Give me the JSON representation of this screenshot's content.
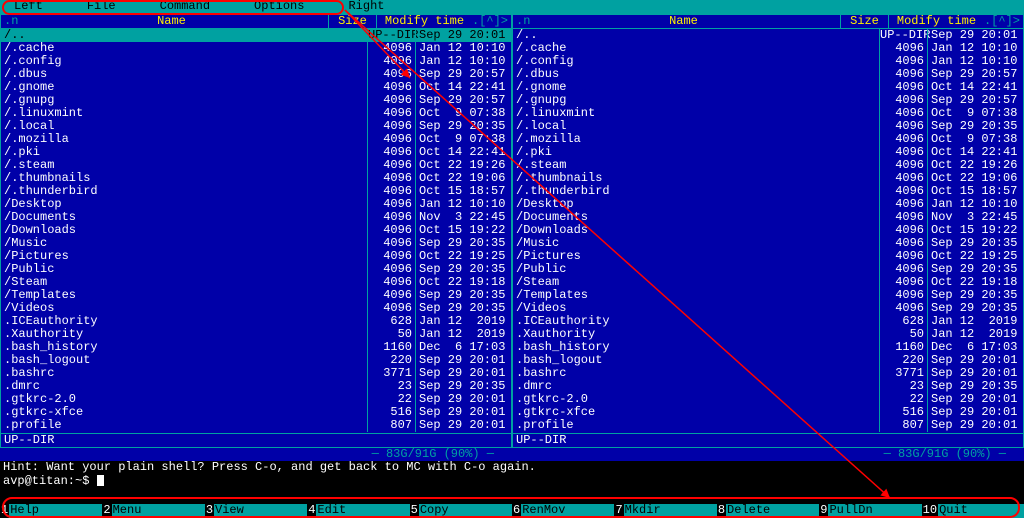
{
  "menubar": [
    "Left",
    "File",
    "Command",
    "Options",
    "Right"
  ],
  "header": {
    "dotn": ".n",
    "name": "Name",
    "size": "Size",
    "mtime": "Modify time",
    "corner": ".[^]>"
  },
  "selected_row": {
    "name": "/..",
    "size": "UP--DIR",
    "mtime": "Sep 29 20:01"
  },
  "rows": [
    {
      "name": "/.cache",
      "size": "4096",
      "mtime": "Jan 12 10:10"
    },
    {
      "name": "/.config",
      "size": "4096",
      "mtime": "Jan 12 10:10"
    },
    {
      "name": "/.dbus",
      "size": "4096",
      "mtime": "Sep 29 20:57"
    },
    {
      "name": "/.gnome",
      "size": "4096",
      "mtime": "Oct 14 22:41"
    },
    {
      "name": "/.gnupg",
      "size": "4096",
      "mtime": "Sep 29 20:57"
    },
    {
      "name": "/.linuxmint",
      "size": "4096",
      "mtime": "Oct  9 07:38"
    },
    {
      "name": "/.local",
      "size": "4096",
      "mtime": "Sep 29 20:35"
    },
    {
      "name": "/.mozilla",
      "size": "4096",
      "mtime": "Oct  9 07:38"
    },
    {
      "name": "/.pki",
      "size": "4096",
      "mtime": "Oct 14 22:41"
    },
    {
      "name": "/.steam",
      "size": "4096",
      "mtime": "Oct 22 19:26"
    },
    {
      "name": "/.thumbnails",
      "size": "4096",
      "mtime": "Oct 22 19:06"
    },
    {
      "name": "/.thunderbird",
      "size": "4096",
      "mtime": "Oct 15 18:57"
    },
    {
      "name": "/Desktop",
      "size": "4096",
      "mtime": "Jan 12 10:10"
    },
    {
      "name": "/Documents",
      "size": "4096",
      "mtime": "Nov  3 22:45"
    },
    {
      "name": "/Downloads",
      "size": "4096",
      "mtime": "Oct 15 19:22"
    },
    {
      "name": "/Music",
      "size": "4096",
      "mtime": "Sep 29 20:35"
    },
    {
      "name": "/Pictures",
      "size": "4096",
      "mtime": "Oct 22 19:25"
    },
    {
      "name": "/Public",
      "size": "4096",
      "mtime": "Sep 29 20:35"
    },
    {
      "name": "/Steam",
      "size": "4096",
      "mtime": "Oct 22 19:18"
    },
    {
      "name": "/Templates",
      "size": "4096",
      "mtime": "Sep 29 20:35"
    },
    {
      "name": "/Videos",
      "size": "4096",
      "mtime": "Sep 29 20:35"
    },
    {
      "name": " .ICEauthority",
      "size": "628",
      "mtime": "Jan 12  2019"
    },
    {
      "name": " .Xauthority",
      "size": "50",
      "mtime": "Jan 12  2019"
    },
    {
      "name": " .bash_history",
      "size": "1160",
      "mtime": "Dec  6 17:03"
    },
    {
      "name": " .bash_logout",
      "size": "220",
      "mtime": "Sep 29 20:01"
    },
    {
      "name": " .bashrc",
      "size": "3771",
      "mtime": "Sep 29 20:01"
    },
    {
      "name": " .dmrc",
      "size": "23",
      "mtime": "Sep 29 20:35"
    },
    {
      "name": " .gtkrc-2.0",
      "size": "22",
      "mtime": "Sep 29 20:01"
    },
    {
      "name": " .gtkrc-xfce",
      "size": "516",
      "mtime": "Sep 29 20:01"
    },
    {
      "name": " .profile",
      "size": "807",
      "mtime": "Sep 29 20:01"
    }
  ],
  "status": "UP--DIR",
  "diskfree": "─ 83G/91G (90%) ─",
  "hint": "Hint: Want your plain shell? Press C-o, and get back to MC with C-o again.",
  "prompt": "avp@titan:~$ ",
  "fkeys": [
    {
      "n": "1",
      "l": "Help"
    },
    {
      "n": "2",
      "l": "Menu"
    },
    {
      "n": "3",
      "l": "View"
    },
    {
      "n": "4",
      "l": "Edit"
    },
    {
      "n": "5",
      "l": "Copy"
    },
    {
      "n": "6",
      "l": "RenMov"
    },
    {
      "n": "7",
      "l": "Mkdir"
    },
    {
      "n": "8",
      "l": "Delete"
    },
    {
      "n": "9",
      "l": "PullDn"
    },
    {
      "n": "10",
      "l": "Quit"
    }
  ]
}
